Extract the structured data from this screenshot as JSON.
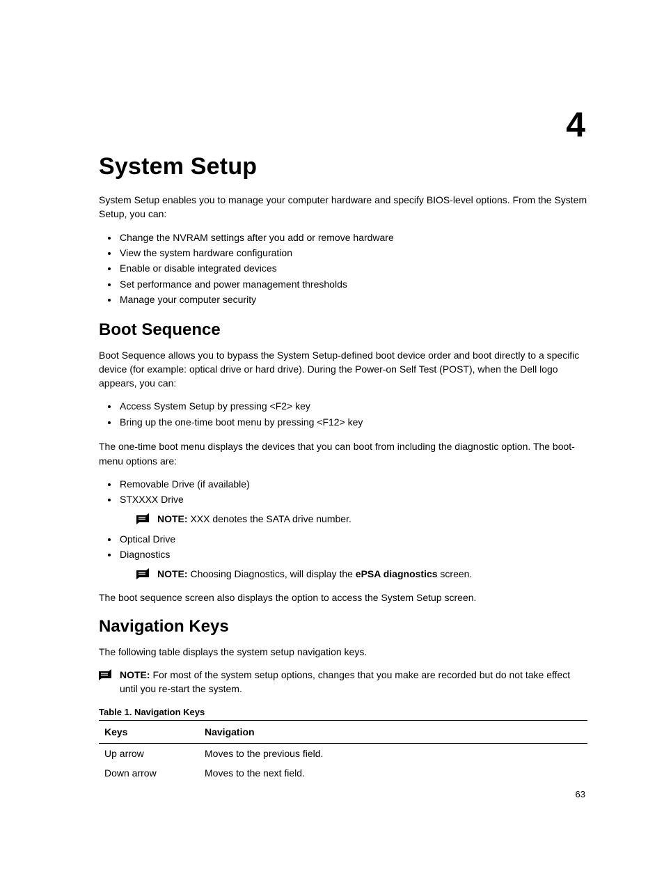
{
  "chapter_number": "4",
  "title": "System Setup",
  "intro": "System Setup enables you to manage your computer hardware and specify BIOS-level options. From the System Setup, you can:",
  "intro_bullets": [
    "Change the NVRAM settings after you add or remove hardware",
    "View the system hardware configuration",
    "Enable or disable integrated devices",
    "Set performance and power management thresholds",
    "Manage your computer security"
  ],
  "boot": {
    "heading": "Boot Sequence",
    "p1": "Boot Sequence allows you to bypass the System Setup‐defined boot device order and boot directly to a specific device (for example: optical drive or hard drive). During the Power-on Self Test (POST), when the Dell logo appears, you can:",
    "list1": [
      "Access System Setup by pressing <F2> key",
      "Bring up the one-time boot menu by pressing <F12> key"
    ],
    "p2": "The one-time boot menu displays the devices that you can boot from including the diagnostic option. The boot-menu options are:",
    "list2_item1": "Removable Drive (if available)",
    "list2_item2": "STXXXX Drive",
    "note1_label": "NOTE:",
    "note1_text": " XXX denotes the SATA drive number.",
    "list2_item3": "Optical Drive",
    "list2_item4": "Diagnostics",
    "note2_label": "NOTE:",
    "note2_text_a": " Choosing Diagnostics, will display the ",
    "note2_bold": "ePSA diagnostics",
    "note2_text_b": " screen.",
    "p3": "The boot sequence screen also displays the option to access the System Setup screen."
  },
  "nav": {
    "heading": "Navigation Keys",
    "p1": "The following table displays the system setup navigation keys.",
    "note_label": "NOTE:",
    "note_text": " For most of the system setup options, changes that you make are recorded but do not take effect until you re-start the system.",
    "table_caption": "Table 1. Navigation Keys",
    "col_keys": "Keys",
    "col_nav": "Navigation",
    "rows": [
      {
        "keys": "Up arrow",
        "nav": "Moves to the previous field."
      },
      {
        "keys": "Down arrow",
        "nav": "Moves to the next field."
      }
    ]
  },
  "page_number": "63"
}
